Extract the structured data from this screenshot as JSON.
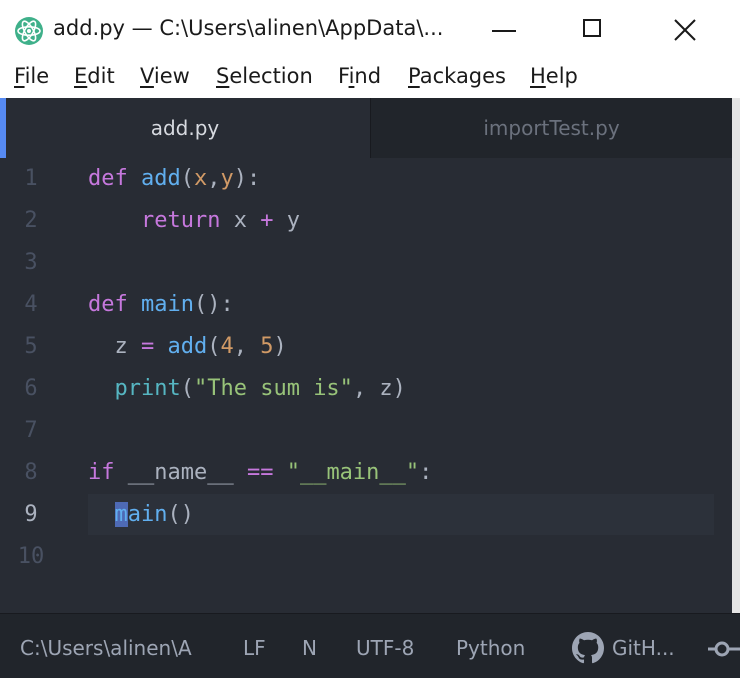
{
  "window": {
    "title": "add.py — C:\\Users\\alinen\\AppData\\...",
    "app_icon": "atom-icon"
  },
  "menu": [
    {
      "pre": "",
      "ul": "F",
      "post": "ile"
    },
    {
      "pre": "",
      "ul": "E",
      "post": "dit"
    },
    {
      "pre": "",
      "ul": "V",
      "post": "iew"
    },
    {
      "pre": "",
      "ul": "S",
      "post": "election"
    },
    {
      "pre": "F",
      "ul": "i",
      "post": "nd"
    },
    {
      "pre": "",
      "ul": "P",
      "post": "ackages"
    },
    {
      "pre": "",
      "ul": "H",
      "post": "elp"
    }
  ],
  "tabs": [
    {
      "label": "add.py",
      "active": true
    },
    {
      "label": "importTest.py",
      "active": false
    }
  ],
  "editor": {
    "line_numbers": [
      "1",
      "2",
      "3",
      "4",
      "5",
      "6",
      "7",
      "8",
      "9",
      "10"
    ],
    "active_line": "9",
    "code": {
      "l1": {
        "kw": "def",
        "sp": " ",
        "fn": "add",
        "p1": "(",
        "a1": "x",
        "c": ",",
        "a2": "y",
        "p2": "):"
      },
      "l2": {
        "indent": "    ",
        "kw": "return",
        "t1": " x ",
        "op": "+",
        "t2": " y"
      },
      "l4": {
        "kw": "def",
        "sp": " ",
        "fn": "main",
        "p": "():"
      },
      "l5": {
        "indent": "  ",
        "v": "z ",
        "op": "=",
        "sp": " ",
        "fn": "add",
        "p1": "(",
        "n1": "4",
        "c": ", ",
        "n2": "5",
        "p2": ")"
      },
      "l6": {
        "indent": "  ",
        "bi": "print",
        "p1": "(",
        "st": "\"The sum is\"",
        "rest": ", z)"
      },
      "l8": {
        "kw": "if",
        "t1": " __name__ ",
        "op": "==",
        "sp": " ",
        "st": "\"__main__\"",
        "p": ":"
      },
      "l9": {
        "indent": "  ",
        "cur": "m",
        "fn": "ain",
        "p": "()"
      }
    }
  },
  "status": {
    "path": "C:\\Users\\alinen\\A",
    "line_ending": "LF",
    "indicator": "N",
    "encoding": "UTF-8",
    "grammar": "Python",
    "github": "GitH..."
  },
  "colors": {
    "editor_bg": "#282c34",
    "keyword": "#c678dd",
    "function": "#61afef",
    "string": "#98c379",
    "number": "#d19a66",
    "accent": "#568af2"
  }
}
